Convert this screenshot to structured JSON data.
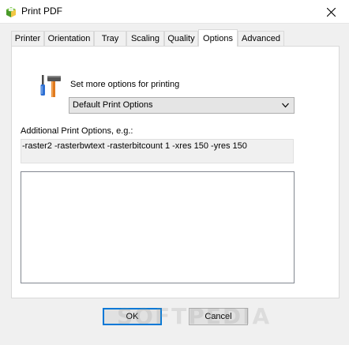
{
  "window": {
    "title": "Print PDF",
    "close_icon": "close-icon",
    "app_icon": "printer-app-icon"
  },
  "tabs": [
    {
      "label": "Printer",
      "active": false
    },
    {
      "label": "Orientation",
      "active": false
    },
    {
      "label": "Tray",
      "active": false
    },
    {
      "label": "Scaling",
      "active": false
    },
    {
      "label": "Quality",
      "active": false
    },
    {
      "label": "Options",
      "active": true
    },
    {
      "label": "Advanced",
      "active": false
    }
  ],
  "options_panel": {
    "section_icon": "tools-icon",
    "set_more_label": "Set more options for printing",
    "preset_select": {
      "value": "Default Print Options"
    },
    "additional_label": "Additional Print Options, e.g.:",
    "example_value": "-raster2 -rasterbwtext -rasterbitcount 1 -xres 150 -yres 150",
    "custom_options_value": ""
  },
  "buttons": {
    "ok": "OK",
    "cancel": "Cancel"
  },
  "watermark": "SOFTPEDIA",
  "colors": {
    "focus_border": "#0078d7",
    "panel_bg": "#ffffff",
    "dialog_bg": "#f0f0f0"
  }
}
